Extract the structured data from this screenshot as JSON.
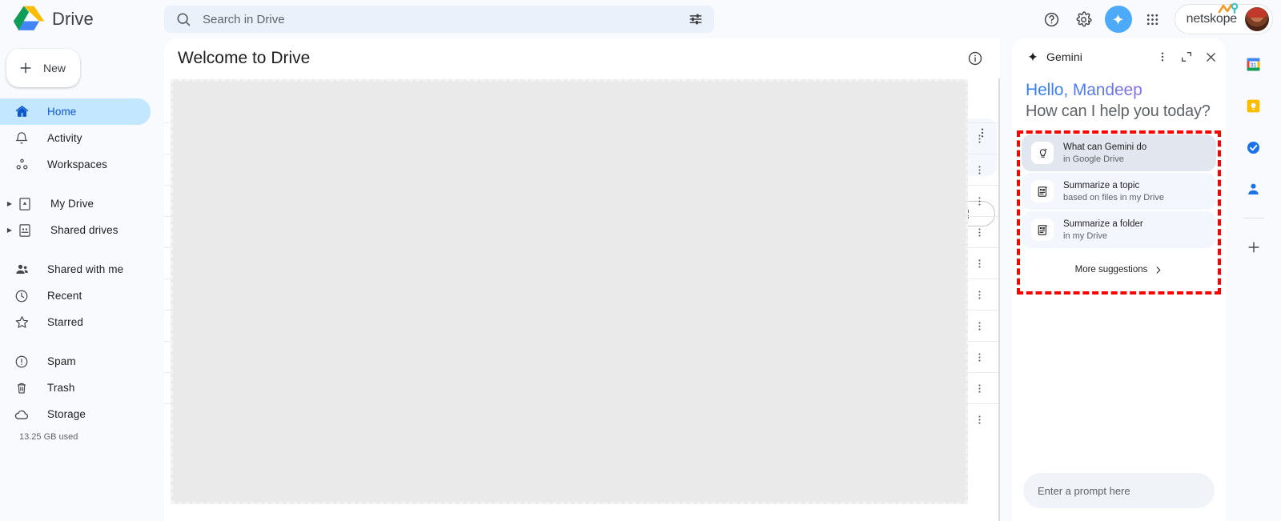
{
  "topbar": {
    "brand": "Drive",
    "logo_icon": "google-drive-logo",
    "search": {
      "placeholder": "Search in Drive",
      "value": "",
      "icon": "search-icon",
      "filter_icon": "tune-icon"
    },
    "actions": [
      {
        "name": "help-button",
        "icon": "help-circle-icon"
      },
      {
        "name": "settings-button",
        "icon": "gear-icon"
      },
      {
        "name": "gemini-toggle-button",
        "icon": "sparkle-icon",
        "color": "#4daaf8"
      },
      {
        "name": "google-apps-button",
        "icon": "apps-grid-icon"
      }
    ],
    "account": {
      "org": "netskope",
      "org_logo_icon": "netskope-logo-icon",
      "avatar_icon": "user-avatar"
    }
  },
  "sidebar": {
    "new_button": {
      "label": "New",
      "icon": "plus-icon"
    },
    "items": [
      {
        "label": "Home",
        "icon": "home-icon",
        "active": true,
        "expandable": false
      },
      {
        "label": "Activity",
        "icon": "bell-icon",
        "active": false,
        "expandable": false
      },
      {
        "label": "Workspaces",
        "icon": "workspaces-icon",
        "active": false,
        "expandable": false
      },
      {
        "label": "My Drive",
        "icon": "my-drive-icon",
        "active": false,
        "expandable": true
      },
      {
        "label": "Shared drives",
        "icon": "shared-drives-icon",
        "active": false,
        "expandable": true
      },
      {
        "label": "Shared with me",
        "icon": "people-icon",
        "active": false,
        "expandable": false
      },
      {
        "label": "Recent",
        "icon": "clock-icon",
        "active": false,
        "expandable": false
      },
      {
        "label": "Starred",
        "icon": "star-icon",
        "active": false,
        "expandable": false
      },
      {
        "label": "Spam",
        "icon": "spam-icon",
        "active": false,
        "expandable": false
      },
      {
        "label": "Trash",
        "icon": "trash-icon",
        "active": false,
        "expandable": false
      },
      {
        "label": "Storage",
        "icon": "cloud-icon",
        "active": false,
        "expandable": false
      }
    ],
    "storage_used": "13.25 GB used"
  },
  "main": {
    "title": "Welcome to Drive",
    "info_icon": "info-circle-icon",
    "row_menu_icon": "more-vert-icon",
    "view_toggle_icon": "grid-view-icon",
    "row_count": 9
  },
  "gemini": {
    "title": "Gemini",
    "title_icon": "sparkle-icon",
    "header_actions": [
      {
        "name": "gemini-more-options-button",
        "icon": "more-vert-icon"
      },
      {
        "name": "gemini-expand-button",
        "icon": "expand-icon"
      },
      {
        "name": "gemini-close-button",
        "icon": "close-icon"
      }
    ],
    "greeting_hello": "Hello, Mandeep",
    "greeting_sub": "How can I help you today?",
    "greeting_gradient_from": "#2d7ff9",
    "greeting_gradient_to": "#8a6fe8",
    "suggestions": [
      {
        "title": "What can Gemini do",
        "subtitle": "in Google Drive",
        "icon": "idea-sparkle-icon",
        "hovered": true
      },
      {
        "title": "Summarize a topic",
        "subtitle": "based on files in my Drive",
        "icon": "summarize-doc-icon",
        "hovered": false
      },
      {
        "title": "Summarize a folder",
        "subtitle": "in my Drive",
        "icon": "summarize-folder-icon",
        "hovered": false
      }
    ],
    "more_suggestions": {
      "label": "More suggestions",
      "icon": "chevron-right-icon"
    },
    "prompt": {
      "placeholder": "Enter a prompt here",
      "value": ""
    }
  },
  "rail": {
    "items": [
      {
        "name": "google-calendar-icon",
        "label": "Calendar"
      },
      {
        "name": "google-keep-icon",
        "label": "Keep"
      },
      {
        "name": "google-tasks-icon",
        "label": "Tasks"
      },
      {
        "name": "google-contacts-icon",
        "label": "Contacts"
      },
      {
        "name": "add-addon-icon",
        "label": "Get add-ons"
      }
    ]
  },
  "annotation": {
    "color": "#ff0000",
    "style": "dashed-rectangle"
  }
}
